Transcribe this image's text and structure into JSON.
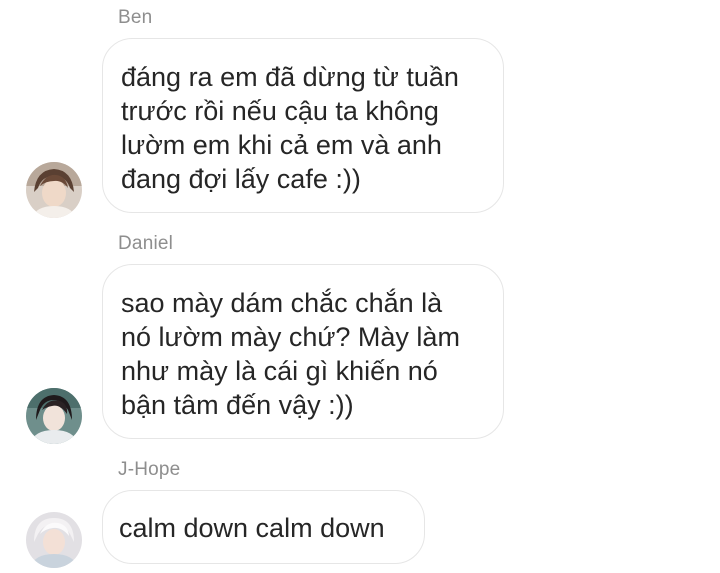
{
  "messages": [
    {
      "sender": "Ben",
      "lines": [
        "đáng ra em đã dừng từ tuần",
        "trước rồi nếu cậu ta không",
        "lườm em khi cả em và anh",
        "đang đợi lấy cafe :))"
      ]
    },
    {
      "sender": "Daniel",
      "lines": [
        "sao mày dám chắc chắn là",
        "nó lườm mày chứ? Mày làm",
        "như mày là cái gì khiến nó",
        "bận tâm đến vậy :))"
      ]
    },
    {
      "sender": "J-Hope",
      "lines": [
        "calm down calm down"
      ]
    }
  ],
  "colors": {
    "sender_name": "#8e8e8e",
    "bubble_border": "#e6e6e6",
    "message_text": "#262626",
    "background": "#ffffff"
  },
  "icons": {
    "avatar_ben": "avatar-photo",
    "avatar_daniel": "avatar-photo",
    "avatar_jhope": "avatar-photo"
  }
}
